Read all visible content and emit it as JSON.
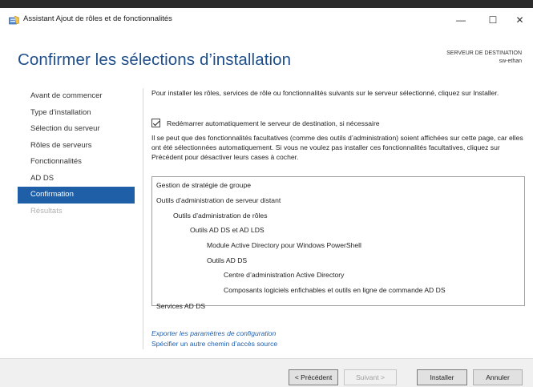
{
  "window": {
    "title": "Assistant Ajout de rôles et de fonctionnalités",
    "controls": {
      "minimize": "—",
      "maximize": "☐",
      "close": "✕"
    }
  },
  "header": {
    "page_title": "Confirmer les sélections d’installation",
    "destination_label": "SERVEUR DE DESTINATION",
    "destination_server": "sw-ethan"
  },
  "sidebar": {
    "items": [
      {
        "label": "Avant de commencer",
        "state": "normal"
      },
      {
        "label": "Type d’installation",
        "state": "normal"
      },
      {
        "label": "Sélection du serveur",
        "state": "normal"
      },
      {
        "label": "Rôles de serveurs",
        "state": "normal"
      },
      {
        "label": "Fonctionnalités",
        "state": "normal"
      },
      {
        "label": "AD DS",
        "state": "normal"
      },
      {
        "label": "Confirmation",
        "state": "active"
      },
      {
        "label": "Résultats",
        "state": "disabled"
      }
    ]
  },
  "content": {
    "intro": "Pour installer les rôles, services de rôle ou fonctionnalités suivants sur le serveur sélectionné, cliquez sur Installer.",
    "restart_checkbox": {
      "label": "Redémarrer automatiquement le serveur de destination, si nécessaire",
      "checked": true
    },
    "note": "Il se peut que des fonctionnalités facultatives (comme des outils d’administration) soient affichées sur cette page, car elles ont été sélectionnées automatiquement. Si vous ne voulez pas installer ces fonctionnalités facultatives, cliquez sur Précédent pour désactiver leurs cases à cocher.",
    "selections": [
      {
        "label": "Gestion de stratégie de groupe",
        "level": 0
      },
      {
        "label": "Outils d’administration de serveur distant",
        "level": 0
      },
      {
        "label": "Outils d’administration de rôles",
        "level": 1
      },
      {
        "label": "Outils AD DS et AD LDS",
        "level": 2
      },
      {
        "label": "Module Active Directory pour Windows PowerShell",
        "level": 3
      },
      {
        "label": "Outils AD DS",
        "level": 3
      },
      {
        "label": "Centre d’administration Active Directory",
        "level": 4
      },
      {
        "label": "Composants logiciels enfichables et outils en ligne de commande AD DS",
        "level": 4
      },
      {
        "label": "Services AD DS",
        "level": 0
      }
    ],
    "links": {
      "export": "Exporter les paramètres de configuration",
      "alternate_source": "Spécifier un autre chemin d’accès source"
    }
  },
  "footer": {
    "previous": "< Précédent",
    "next": "Suivant >",
    "install": "Installer",
    "cancel": "Annuler"
  },
  "colors": {
    "title_blue": "#1e4f8c",
    "active_nav": "#1f5fa7",
    "link_blue": "#1e5fb0",
    "footer_bg": "#f0f0f0"
  }
}
